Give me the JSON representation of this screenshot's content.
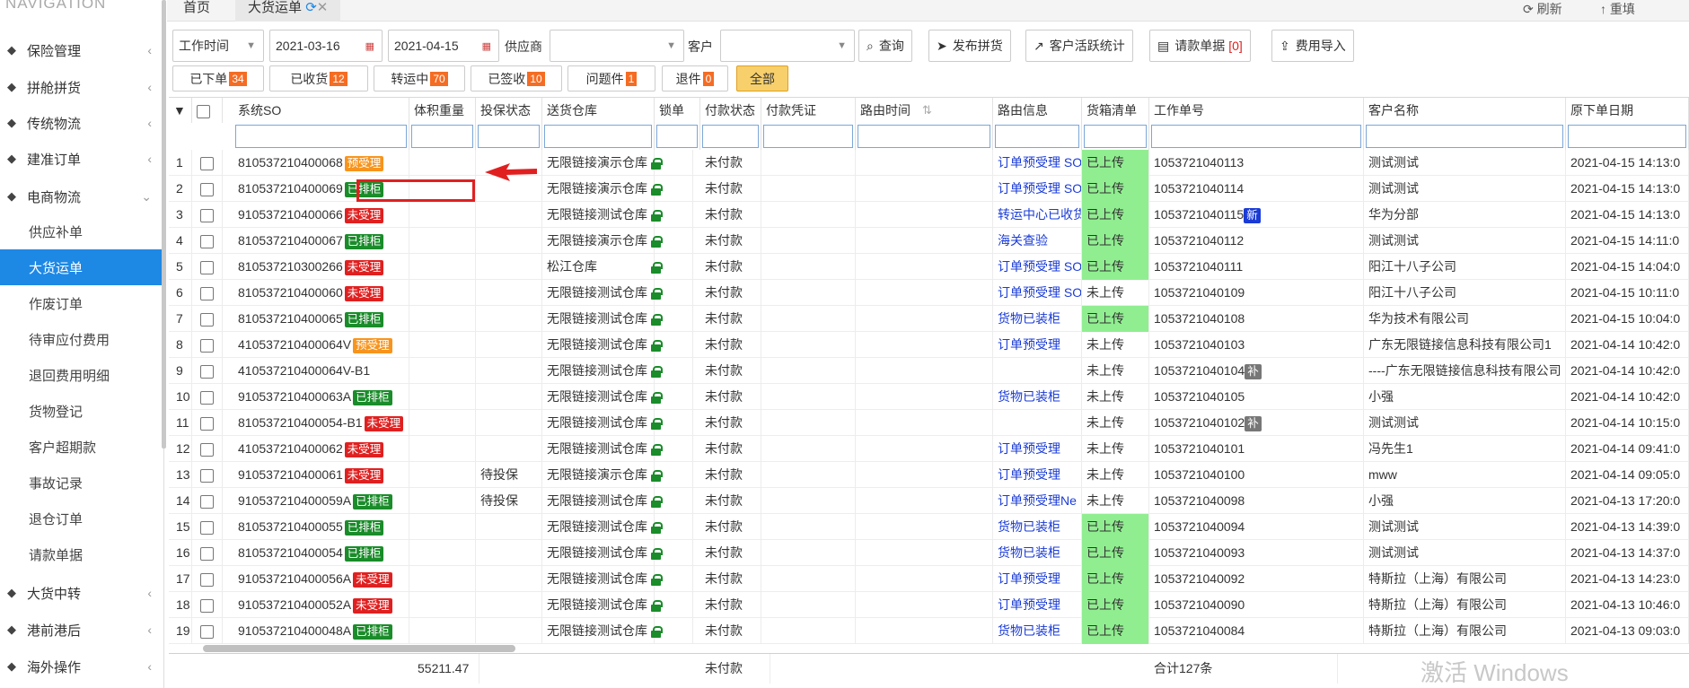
{
  "nav": {
    "title": "NAVIGATION",
    "items": [
      {
        "label": "保险管理",
        "icon": "shield-icon"
      },
      {
        "label": "拼舱拼货",
        "icon": "list-icon"
      },
      {
        "label": "传统物流",
        "icon": "truck-icon"
      },
      {
        "label": "建准订单",
        "icon": "link-icon"
      },
      {
        "label": "电商物流",
        "icon": "globe-icon"
      }
    ],
    "sub": [
      "供应补单",
      "大货运单",
      "作废订单",
      "待审应付费用",
      "退回费用明细",
      "货物登记",
      "客户超期款",
      "事故记录",
      "退仓订单",
      "请款单据"
    ],
    "bottom": [
      {
        "label": "大货中转",
        "icon": "grid-icon"
      },
      {
        "label": "港前港后",
        "icon": "ship-icon"
      },
      {
        "label": "海外操作",
        "icon": "user-icon"
      }
    ]
  },
  "tabs": {
    "home": "首页",
    "current": "大货运单",
    "refresh": "刷新",
    "reset": "重填"
  },
  "filters": {
    "time_type": "工作时间",
    "date_from": "2021-03-16",
    "date_to": "2021-04-15",
    "supplier_label": "供应商",
    "customer_label": "客户"
  },
  "buttons": {
    "query": "查询",
    "publish": "发布拼货",
    "stats": "客户活跃统计",
    "invoice": "请款单据",
    "invoice_count": "[0]",
    "import": "费用导入"
  },
  "status": [
    {
      "label": "已下单",
      "count": "34"
    },
    {
      "label": "已收货",
      "count": "12"
    },
    {
      "label": "转运中",
      "count": "70"
    },
    {
      "label": "已签收",
      "count": "10"
    },
    {
      "label": "问题件",
      "count": "1"
    },
    {
      "label": "退件",
      "count": "0"
    }
  ],
  "status_all": "全部",
  "columns": [
    "系统SO",
    "体积重量",
    "投保状态",
    "送货仓库",
    "锁单",
    "付款状态",
    "付款凭证",
    "路由时间",
    "路由信息",
    "货箱清单",
    "工作单号",
    "客户名称",
    "原下单日期"
  ],
  "rows": [
    {
      "n": "1",
      "so": "810537210400068",
      "tag": "预受理",
      "tc": "orange",
      "ins": "",
      "wh": "无限链接演示仓库",
      "pay": "未付款",
      "route": "订单预受理 SO",
      "box": "已上传",
      "bg": true,
      "job": "1053721040113",
      "jt": "",
      "cust": "测试测试",
      "date": "2021-04-15 14:13:0"
    },
    {
      "n": "2",
      "so": "810537210400069",
      "tag": "已排柜",
      "tc": "green",
      "ins": "",
      "wh": "无限链接演示仓库",
      "pay": "未付款",
      "route": "订单预受理 SO",
      "box": "已上传",
      "bg": true,
      "job": "1053721040114",
      "jt": "",
      "cust": "测试测试",
      "date": "2021-04-15 14:13:0"
    },
    {
      "n": "3",
      "so": "910537210400066",
      "tag": "未受理",
      "tc": "red",
      "ins": "",
      "wh": "无限链接测试仓库",
      "pay": "未付款",
      "route": "转运中心已收货",
      "box": "已上传",
      "bg": true,
      "job": "1053721040115",
      "jt": "新",
      "cust": "华为分部",
      "date": "2021-04-15 14:13:0"
    },
    {
      "n": "4",
      "so": "810537210400067",
      "tag": "已排柜",
      "tc": "green",
      "ins": "",
      "wh": "无限链接演示仓库",
      "pay": "未付款",
      "route": "海关查验",
      "box": "已上传",
      "bg": true,
      "job": "1053721040112",
      "jt": "",
      "cust": "测试测试",
      "date": "2021-04-15 14:11:0"
    },
    {
      "n": "5",
      "so": "810537210300266",
      "tag": "未受理",
      "tc": "red",
      "ins": "",
      "wh": "松江仓库",
      "pay": "未付款",
      "route": "订单预受理 SO",
      "box": "已上传",
      "bg": true,
      "job": "1053721040111",
      "jt": "",
      "cust": "阳江十八子公司",
      "date": "2021-04-15 14:04:0"
    },
    {
      "n": "6",
      "so": "810537210400060",
      "tag": "未受理",
      "tc": "red",
      "ins": "",
      "wh": "无限链接测试仓库",
      "pay": "未付款",
      "route": "订单预受理 SO",
      "box": "未上传",
      "bg": false,
      "job": "1053721040109",
      "jt": "",
      "cust": "阳江十八子公司",
      "date": "2021-04-15 10:11:0"
    },
    {
      "n": "7",
      "so": "810537210400065",
      "tag": "已排柜",
      "tc": "green",
      "ins": "",
      "wh": "无限链接测试仓库",
      "pay": "未付款",
      "route": "货物已装柜",
      "box": "已上传",
      "bg": true,
      "job": "1053721040108",
      "jt": "",
      "cust": "华为技术有限公司",
      "date": "2021-04-15 10:04:0"
    },
    {
      "n": "8",
      "so": "410537210400064V",
      "tag": "预受理",
      "tc": "orange",
      "ins": "",
      "wh": "无限链接测试仓库",
      "pay": "未付款",
      "route": "订单预受理",
      "box": "未上传",
      "bg": false,
      "job": "1053721040103",
      "jt": "",
      "cust": "广东无限链接信息科技有限公司1",
      "date": "2021-04-14 10:42:0"
    },
    {
      "n": "9",
      "so": "410537210400064V-B1",
      "tag": "",
      "tc": "",
      "ins": "",
      "wh": "无限链接测试仓库",
      "pay": "未付款",
      "route": "",
      "box": "未上传",
      "bg": false,
      "job": "1053721040104",
      "jt": "补",
      "cust": "----广东无限链接信息科技有限公司",
      "date": "2021-04-14 10:42:0"
    },
    {
      "n": "10",
      "so": "910537210400063A",
      "tag": "已排柜",
      "tc": "green",
      "ins": "",
      "wh": "无限链接测试仓库",
      "pay": "未付款",
      "route": "货物已装柜",
      "box": "未上传",
      "bg": false,
      "job": "1053721040105",
      "jt": "",
      "cust": "小强",
      "date": "2021-04-14 10:42:0"
    },
    {
      "n": "11",
      "so": "810537210400054-B1",
      "tag": "未受理",
      "tc": "red",
      "ins": "",
      "wh": "无限链接测试仓库",
      "pay": "未付款",
      "route": "",
      "box": "未上传",
      "bg": false,
      "job": "1053721040102",
      "jt": "补",
      "cust": "测试测试",
      "date": "2021-04-14 10:15:0"
    },
    {
      "n": "12",
      "so": "410537210400062",
      "tag": "未受理",
      "tc": "red",
      "ins": "",
      "wh": "无限链接测试仓库",
      "pay": "未付款",
      "route": "订单预受理",
      "box": "未上传",
      "bg": false,
      "job": "1053721040101",
      "jt": "",
      "cust": "冯先生1",
      "date": "2021-04-14 09:41:0"
    },
    {
      "n": "13",
      "so": "910537210400061",
      "tag": "未受理",
      "tc": "red",
      "ins": "待投保",
      "wh": "无限链接演示仓库",
      "pay": "未付款",
      "route": "订单预受理",
      "box": "未上传",
      "bg": false,
      "job": "1053721040100",
      "jt": "",
      "cust": "mww",
      "date": "2021-04-14 09:05:0"
    },
    {
      "n": "14",
      "so": "910537210400059A",
      "tag": "已排柜",
      "tc": "green",
      "ins": "待投保",
      "wh": "无限链接测试仓库",
      "pay": "未付款",
      "route": "订单预受理Ne",
      "box": "未上传",
      "bg": false,
      "job": "1053721040098",
      "jt": "",
      "cust": "小强",
      "date": "2021-04-13 17:20:0"
    },
    {
      "n": "15",
      "so": "810537210400055",
      "tag": "已排柜",
      "tc": "green",
      "ins": "",
      "wh": "无限链接测试仓库",
      "pay": "未付款",
      "route": "货物已装柜",
      "box": "已上传",
      "bg": true,
      "job": "1053721040094",
      "jt": "",
      "cust": "测试测试",
      "date": "2021-04-13 14:39:0"
    },
    {
      "n": "16",
      "so": "810537210400054",
      "tag": "已排柜",
      "tc": "green",
      "ins": "",
      "wh": "无限链接测试仓库",
      "pay": "未付款",
      "route": "货物已装柜",
      "box": "已上传",
      "bg": true,
      "job": "1053721040093",
      "jt": "",
      "cust": "测试测试",
      "date": "2021-04-13 14:37:0"
    },
    {
      "n": "17",
      "so": "910537210400056A",
      "tag": "未受理",
      "tc": "red",
      "ins": "",
      "wh": "无限链接测试仓库",
      "pay": "未付款",
      "route": "订单预受理",
      "box": "已上传",
      "bg": true,
      "job": "1053721040092",
      "jt": "",
      "cust": "特斯拉（上海）有限公司",
      "date": "2021-04-13 14:23:0"
    },
    {
      "n": "18",
      "so": "910537210400052A",
      "tag": "未受理",
      "tc": "red",
      "ins": "",
      "wh": "无限链接测试仓库",
      "pay": "未付款",
      "route": "订单预受理",
      "box": "已上传",
      "bg": true,
      "job": "1053721040090",
      "jt": "",
      "cust": "特斯拉（上海）有限公司",
      "date": "2021-04-13 10:46:0"
    },
    {
      "n": "19",
      "so": "910537210400048A",
      "tag": "已排柜",
      "tc": "green",
      "ins": "",
      "wh": "无限链接测试仓库",
      "pay": "未付款",
      "route": "货物已装柜",
      "box": "已上传",
      "bg": true,
      "job": "1053721040084",
      "jt": "",
      "cust": "特斯拉（上海）有限公司",
      "date": "2021-04-13 09:03:0"
    }
  ],
  "footer": {
    "volume": "55211.47",
    "pay": "未付款",
    "total": "合计127条"
  },
  "watermark": "激活 Windows",
  "colors": {
    "accent": "#1e88e5",
    "tag_red": "#e02020",
    "tag_green": "#1a8c2a",
    "tag_orange": "#f7941d",
    "uploaded_bg": "#90ee90"
  }
}
